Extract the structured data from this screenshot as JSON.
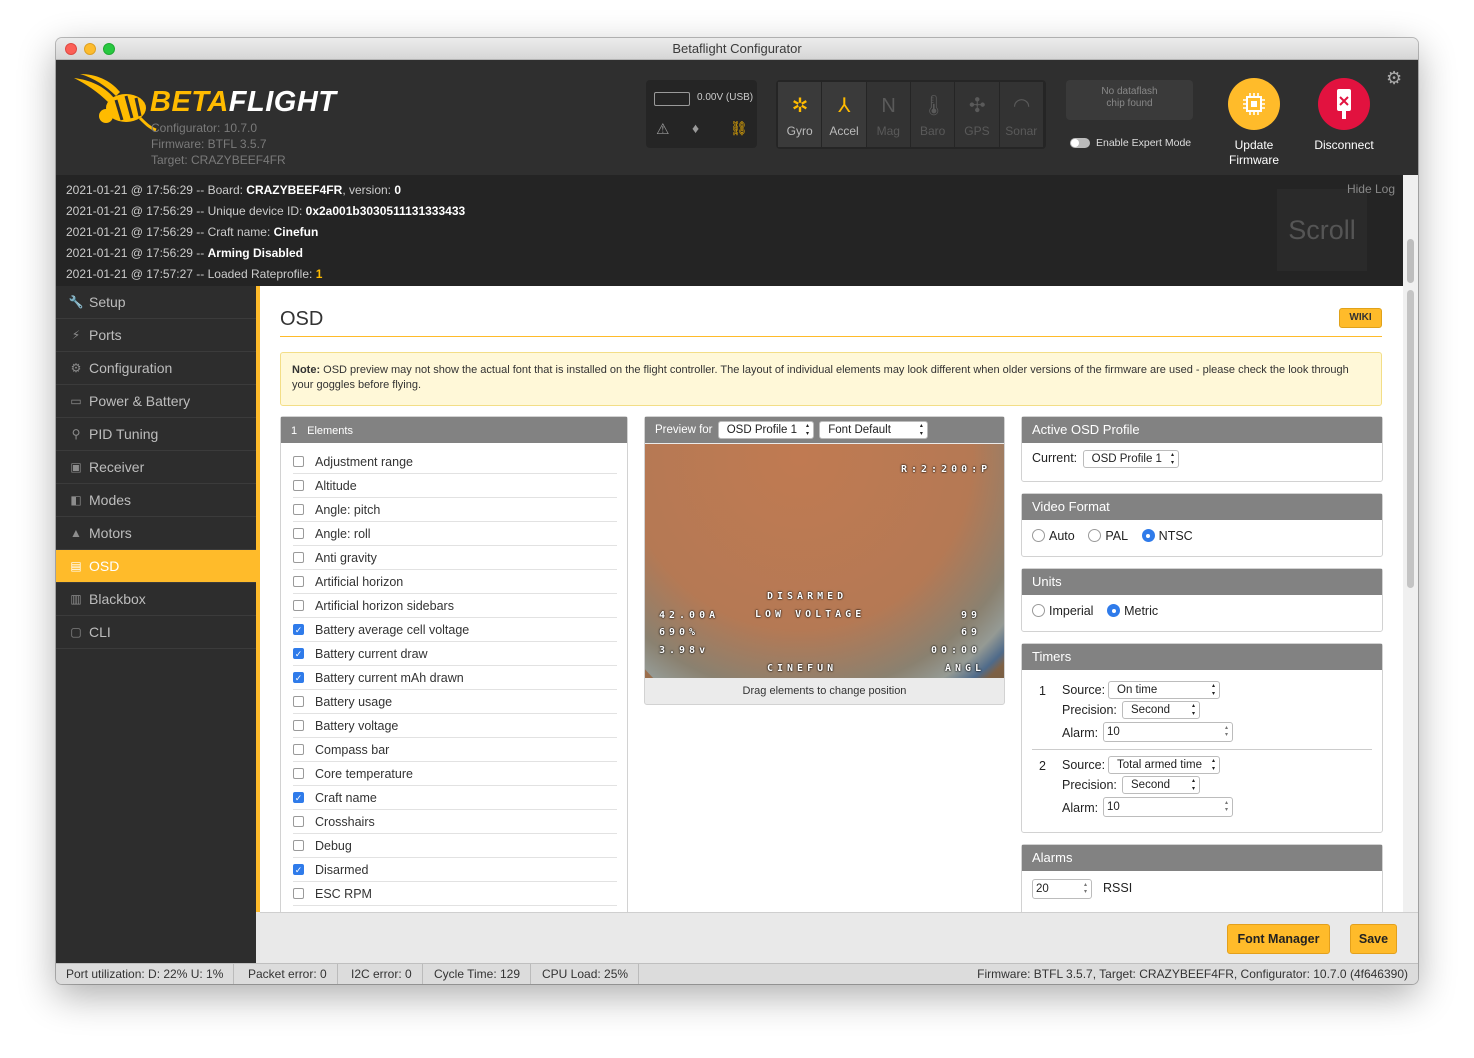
{
  "window": {
    "title": "Betaflight Configurator"
  },
  "header": {
    "logo_brand": "BETA",
    "logo_brand2": "FLIGHT",
    "configurator_version": "Configurator: 10.7.0",
    "firmware": "Firmware: BTFL 3.5.7",
    "target": "Target: CRAZYBEEF4FR",
    "battery_voltage": "0.00V (USB)",
    "sensors": [
      {
        "label": "Gyro",
        "icon": "gyro-icon",
        "active": true
      },
      {
        "label": "Accel",
        "icon": "accel-icon",
        "active": true
      },
      {
        "label": "Mag",
        "icon": "mag-icon",
        "active": false
      },
      {
        "label": "Baro",
        "icon": "baro-icon",
        "active": false
      },
      {
        "label": "GPS",
        "icon": "gps-icon",
        "active": false
      },
      {
        "label": "Sonar",
        "icon": "sonar-icon",
        "active": false
      }
    ],
    "dataflash": "No dataflash chip found",
    "expert_mode": "Enable Expert Mode",
    "update_firmware": "Update Firmware",
    "disconnect": "Disconnect",
    "update_color": "#ffbb2a",
    "disconnect_color": "#e2123f"
  },
  "log": {
    "hide": "Hide Log",
    "scroll": "Scroll",
    "lines": [
      {
        "prefix": "2021-01-21 @ 17:56:29 -- Board: ",
        "bold": "CRAZYBEEF4FR",
        "mid": ", version: ",
        "bold2": "0"
      },
      {
        "prefix": "2021-01-21 @ 17:56:29 -- Unique device ID: ",
        "bold": "0x2a001b3030511131333433"
      },
      {
        "prefix": "2021-01-21 @ 17:56:29 -- Craft name: ",
        "bold": "Cinefun"
      },
      {
        "prefix": "2021-01-21 @ 17:56:29 -- ",
        "bold": "Arming Disabled"
      },
      {
        "prefix": "2021-01-21 @ 17:57:27 -- Loaded Rateprofile: ",
        "highlight": "1"
      }
    ]
  },
  "sidebar": {
    "items": [
      {
        "label": "Setup",
        "icon": "wrench-icon"
      },
      {
        "label": "Ports",
        "icon": "plug-icon"
      },
      {
        "label": "Configuration",
        "icon": "gear-icon"
      },
      {
        "label": "Power & Battery",
        "icon": "battery-icon"
      },
      {
        "label": "PID Tuning",
        "icon": "sitemap-icon"
      },
      {
        "label": "Receiver",
        "icon": "receiver-icon"
      },
      {
        "label": "Modes",
        "icon": "toggle-icon"
      },
      {
        "label": "Motors",
        "icon": "motor-icon"
      },
      {
        "label": "OSD",
        "icon": "osd-icon",
        "active": true
      },
      {
        "label": "Blackbox",
        "icon": "blackbox-icon"
      },
      {
        "label": "CLI",
        "icon": "terminal-icon"
      }
    ]
  },
  "osd": {
    "title": "OSD",
    "wiki": "WIKI",
    "note_label": "Note:",
    "note_text": " OSD preview may not show the actual font that is installed on the flight controller. The layout of individual elements may look different when older versions of the firmware are used - please check the look through your goggles before flying.",
    "elements_header_num": "1",
    "elements_header": "Elements",
    "elements": [
      {
        "label": "Adjustment range",
        "checked": false
      },
      {
        "label": "Altitude",
        "checked": false
      },
      {
        "label": "Angle: pitch",
        "checked": false
      },
      {
        "label": "Angle: roll",
        "checked": false
      },
      {
        "label": "Anti gravity",
        "checked": false
      },
      {
        "label": "Artificial horizon",
        "checked": false
      },
      {
        "label": "Artificial horizon sidebars",
        "checked": false
      },
      {
        "label": "Battery average cell voltage",
        "checked": true
      },
      {
        "label": "Battery current draw",
        "checked": true
      },
      {
        "label": "Battery current mAh drawn",
        "checked": true
      },
      {
        "label": "Battery usage",
        "checked": false
      },
      {
        "label": "Battery voltage",
        "checked": false
      },
      {
        "label": "Compass bar",
        "checked": false
      },
      {
        "label": "Core temperature",
        "checked": false
      },
      {
        "label": "Craft name",
        "checked": true
      },
      {
        "label": "Crosshairs",
        "checked": false
      },
      {
        "label": "Debug",
        "checked": false
      },
      {
        "label": "Disarmed",
        "checked": true
      },
      {
        "label": "ESC RPM",
        "checked": false
      }
    ],
    "preview_for": "Preview for",
    "preview_profile": "OSD Profile 1",
    "preview_font": "Font Default",
    "preview_hint": "Drag elements to change position",
    "osd_overlay": {
      "rssi": "R:2:200:P",
      "disarmed": "DISARMED",
      "low_voltage": "LOW VOLTAGE",
      "current": "42.00A",
      "mah": "690%",
      "cell": "3.98v",
      "craft": "CINEFUN",
      "rssi_val": "99",
      "val2": "69",
      "timer": "00:00",
      "angl": "ANGL"
    },
    "active_profile_header": "Active OSD Profile",
    "current_label": "Current:",
    "current_profile": "OSD Profile 1",
    "video_format_header": "Video Format",
    "video_formats": [
      {
        "label": "Auto",
        "selected": false
      },
      {
        "label": "PAL",
        "selected": false
      },
      {
        "label": "NTSC",
        "selected": true
      }
    ],
    "units_header": "Units",
    "units": [
      {
        "label": "Imperial",
        "selected": false
      },
      {
        "label": "Metric",
        "selected": true
      }
    ],
    "timers_header": "Timers",
    "timers": [
      {
        "num": "1",
        "source_label": "Source:",
        "source": "On time",
        "precision_label": "Precision:",
        "precision": "Second",
        "alarm_label": "Alarm:",
        "alarm": "10"
      },
      {
        "num": "2",
        "source_label": "Source:",
        "source": "Total armed time",
        "precision_label": "Precision:",
        "precision": "Second",
        "alarm_label": "Alarm:",
        "alarm": "10"
      }
    ],
    "alarms_header": "Alarms",
    "alarm_rssi_value": "20",
    "alarm_rssi_label": "RSSI",
    "font_manager": "Font Manager",
    "save": "Save"
  },
  "status": {
    "port": "Port utilization: D: 22% U: 1%",
    "packet": "Packet error: 0",
    "i2c": "I2C error: 0",
    "cycle": "Cycle Time: 129",
    "cpu": "CPU Load: 25%",
    "version": "Firmware: BTFL 3.5.7, Target: CRAZYBEEF4FR, Configurator: 10.7.0 (4f646390)"
  }
}
